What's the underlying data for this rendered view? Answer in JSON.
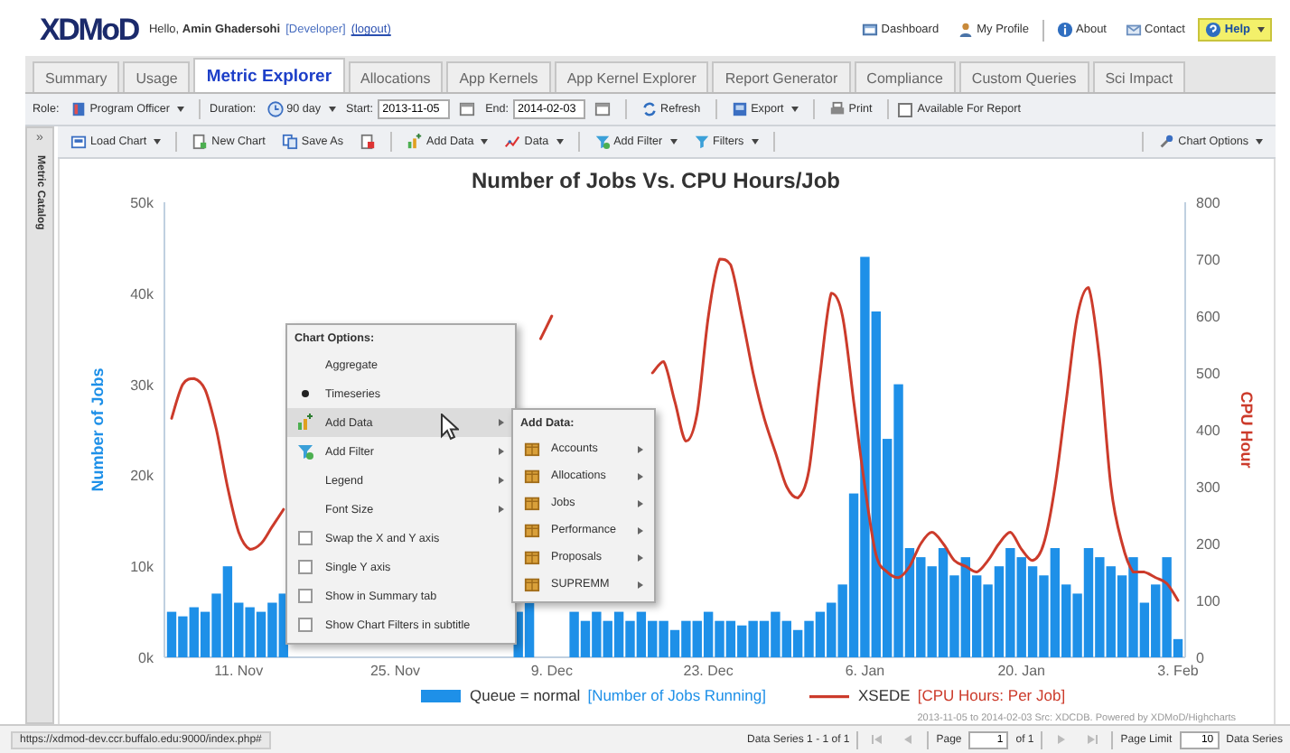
{
  "header": {
    "logo": "XDMoD",
    "greeting": "Hello, **Amin Ghadersohi**",
    "role": "[Developer]",
    "logout": "(logout)",
    "links": [
      {
        "label": "Dashboard",
        "menu": false,
        "highlighted": false
      },
      {
        "label": "My Profile",
        "menu": false,
        "highlighted": false
      },
      {
        "label": "About",
        "menu": false,
        "highlighted": false
      },
      {
        "label": "Contact",
        "menu": false,
        "highlighted": false
      },
      {
        "label": "Help",
        "menu": true,
        "highlighted": true
      }
    ]
  },
  "tabs": [
    {
      "label": "Summary",
      "selected": false
    },
    {
      "label": "Usage",
      "selected": false
    },
    {
      "label": "Metric Explorer",
      "selected": true
    },
    {
      "label": "Allocations",
      "selected": false
    },
    {
      "label": "App Kernels",
      "selected": false
    },
    {
      "label": "App Kernel Explorer",
      "selected": false
    },
    {
      "label": "Report Generator",
      "selected": false
    },
    {
      "label": "Compliance",
      "selected": false
    },
    {
      "label": "Custom Queries",
      "selected": false
    },
    {
      "label": "Sci Impact",
      "selected": false
    }
  ],
  "toolbar": {
    "groups": [
      [
        {
          "kind": "label",
          "text": "Role:"
        },
        {
          "kind": "button",
          "label": "Program Officer",
          "menu": true
        }
      ],
      [
        {
          "kind": "label",
          "text": "Duration:"
        },
        {
          "kind": "button",
          "label": "90 day",
          "menu": true
        },
        {
          "kind": "date",
          "label": "Start:",
          "value": "2013-11-05"
        },
        {
          "kind": "date",
          "label": "End:",
          "value": "2014-02-03"
        }
      ],
      [
        {
          "kind": "button",
          "label": "Refresh",
          "menu": false
        }
      ],
      [
        {
          "kind": "button",
          "label": "Export",
          "menu": true
        }
      ],
      [
        {
          "kind": "button",
          "label": "Print",
          "menu": false
        }
      ],
      [
        {
          "kind": "checkbox",
          "label": "Available For Report",
          "checked": false
        }
      ]
    ]
  },
  "sidebar": {
    "toggle": "»",
    "title": "Metric Catalog"
  },
  "chart_toolbar": {
    "groups": [
      [
        {
          "kind": "button",
          "label": "Load Chart",
          "menu": true
        }
      ],
      [
        {
          "kind": "button",
          "label": "New Chart",
          "menu": false
        },
        {
          "kind": "button",
          "label": "Save As",
          "menu": false
        },
        {
          "kind": "icon"
        }
      ],
      [
        {
          "kind": "button",
          "label": "Add Data",
          "menu": true
        },
        {
          "kind": "button",
          "label": "Data",
          "menu": true
        }
      ],
      [
        {
          "kind": "button",
          "label": "Add Filter",
          "menu": true
        },
        {
          "kind": "button",
          "label": "Filters",
          "menu": true
        }
      ]
    ],
    "right": [
      {
        "kind": "button",
        "label": "Chart Options",
        "menu": true
      }
    ]
  },
  "chart": {
    "chart_data": {
      "type": "bar",
      "title": "Number of Jobs Vs. CPU Hours/Job",
      "ylabel": "Number of Jobs",
      "y2label": "CPU Hour",
      "categories": [
        null,
        null,
        null,
        null,
        null,
        null,
        "11. Nov",
        null,
        null,
        null,
        null,
        null,
        null,
        null,
        null,
        null,
        null,
        null,
        null,
        null,
        "25. Nov",
        null,
        null,
        null,
        null,
        null,
        null,
        null,
        null,
        null,
        null,
        null,
        null,
        null,
        "9. Dec",
        null,
        null,
        null,
        null,
        null,
        null,
        null,
        null,
        null,
        null,
        null,
        null,
        null,
        "23. Dec",
        null,
        null,
        null,
        null,
        null,
        null,
        null,
        null,
        null,
        null,
        null,
        null,
        null,
        "6. Jan",
        null,
        null,
        null,
        null,
        null,
        null,
        null,
        null,
        null,
        null,
        null,
        null,
        null,
        "20. Jan",
        null,
        null,
        null,
        null,
        null,
        null,
        null,
        null,
        null,
        null,
        null,
        null,
        null,
        "3. Feb"
      ],
      "ylim": [
        0,
        50000
      ],
      "yticks": [
        {
          "value": 0,
          "label": "0k"
        },
        {
          "value": 10000,
          "label": "10k"
        },
        {
          "value": 20000,
          "label": "20k"
        },
        {
          "value": 30000,
          "label": "30k"
        },
        {
          "value": 40000,
          "label": "40k"
        },
        {
          "value": 50000,
          "label": "50k"
        }
      ],
      "y2lim": [
        0,
        800
      ],
      "y2ticks": [
        {
          "value": 0,
          "label": "0"
        },
        {
          "value": 100,
          "label": "100"
        },
        {
          "value": 200,
          "label": "200"
        },
        {
          "value": 300,
          "label": "300"
        },
        {
          "value": 400,
          "label": "400"
        },
        {
          "value": 500,
          "label": "500"
        },
        {
          "value": 600,
          "label": "600"
        },
        {
          "value": 700,
          "label": "700"
        },
        {
          "value": 800,
          "label": "800"
        }
      ],
      "legend": "bottom",
      "series": [
        {
          "name": "Queue = normal",
          "color": "#1e90e8",
          "values": [
            5000,
            4500,
            5500,
            5000,
            7000,
            10000,
            6000,
            5500,
            5000,
            6000,
            7000,
            null,
            null,
            null,
            null,
            null,
            null,
            null,
            null,
            null,
            null,
            null,
            null,
            null,
            null,
            null,
            null,
            null,
            null,
            null,
            null,
            5000,
            6000,
            null,
            null,
            null,
            5000,
            4000,
            5000,
            4000,
            5000,
            4000,
            5000,
            4000,
            4000,
            3000,
            4000,
            4000,
            5000,
            4000,
            4000,
            3500,
            4000,
            4000,
            5000,
            4000,
            3000,
            4000,
            5000,
            6000,
            8000,
            18000,
            44000,
            38000,
            24000,
            30000,
            12000,
            11000,
            10000,
            12000,
            9000,
            11000,
            9000,
            8000,
            10000,
            12000,
            11000,
            10000,
            9000,
            12000,
            8000,
            7000,
            12000,
            11000,
            10000,
            9000,
            11000,
            6000,
            8000,
            11000,
            2000
          ]
        },
        {
          "name": "XSEDE",
          "type": "line",
          "axis": "y2",
          "color": "#cc3b2b",
          "values": [
            420,
            480,
            490,
            470,
            400,
            300,
            220,
            190,
            200,
            230,
            260,
            null,
            null,
            null,
            null,
            null,
            null,
            null,
            null,
            null,
            null,
            null,
            null,
            null,
            null,
            null,
            null,
            null,
            null,
            null,
            null,
            null,
            null,
            560,
            600,
            null,
            null,
            null,
            null,
            null,
            null,
            null,
            null,
            500,
            520,
            450,
            380,
            430,
            600,
            700,
            690,
            600,
            500,
            420,
            360,
            300,
            280,
            330,
            500,
            640,
            600,
            450,
            300,
            180,
            150,
            140,
            160,
            200,
            220,
            200,
            170,
            160,
            150,
            170,
            200,
            220,
            190,
            170,
            200,
            300,
            450,
            600,
            650,
            520,
            300,
            200,
            150,
            150,
            140,
            130,
            100
          ]
        }
      ]
    },
    "legend_metrics": [
      {
        "metric": "[Number of Jobs Running]"
      },
      {
        "metric": "[CPU Hours: Per Job]"
      }
    ],
    "credits": "2013-11-05 to 2014-02-03 Src: XDCDB. Powered by XDMoD/Highcharts",
    "menu": {
      "title": "Chart Options:",
      "items": [
        {
          "kind": "radio",
          "label": "Aggregate",
          "selected": false
        },
        {
          "kind": "radio",
          "label": "Timeseries",
          "selected": true
        },
        {
          "kind": "submenu",
          "label": "Add Data",
          "expanded": true
        },
        {
          "kind": "submenu",
          "label": "Add Filter",
          "expanded": false
        },
        {
          "kind": "submenu",
          "label": "Legend",
          "expanded": false
        },
        {
          "kind": "submenu",
          "label": "Font Size",
          "expanded": false
        },
        {
          "kind": "checkbox",
          "label": "Swap the X and Y axis",
          "checked": false
        },
        {
          "kind": "checkbox",
          "label": "Single Y axis",
          "checked": false
        },
        {
          "kind": "checkbox",
          "label": "Show in Summary tab",
          "checked": false
        },
        {
          "kind": "checkbox",
          "label": "Show Chart Filters in subtitle",
          "checked": false
        }
      ]
    },
    "submenu": {
      "title": "Add Data:",
      "items": [
        {
          "label": "Accounts"
        },
        {
          "label": "Allocations"
        },
        {
          "label": "Jobs"
        },
        {
          "label": "Performance"
        },
        {
          "label": "Proposals"
        },
        {
          "label": "SUPREMM"
        }
      ]
    }
  },
  "footer": {
    "status_url": "https://xdmod-dev.ccr.buffalo.edu:9000/index.php#",
    "paging": {
      "summary": "Data Series 1 - 1 of 1",
      "page_label": "Page",
      "page": "1",
      "page_count": "of 1",
      "limit_label": "Page Limit",
      "limit": "10",
      "limit_unit": "Data Series"
    }
  }
}
